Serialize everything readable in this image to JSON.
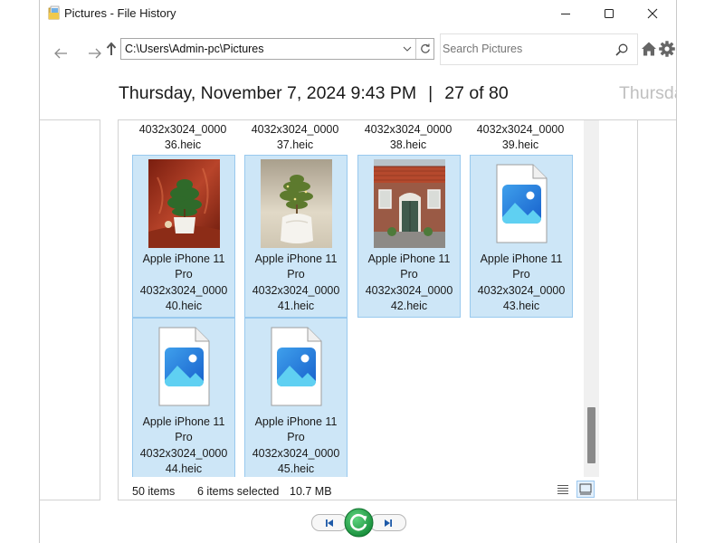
{
  "window": {
    "title": "Pictures - File History"
  },
  "address": {
    "path": "C:\\Users\\Admin-pc\\Pictures"
  },
  "search": {
    "placeholder": "Search Pictures"
  },
  "header": {
    "date": "Thursday, November 7, 2024 9:43 PM",
    "separator": "|",
    "position": "27 of 80",
    "next_date_partial": "Thursda"
  },
  "files": {
    "top_row": [
      {
        "line1": "4032x3024_0000",
        "line2": "36.heic"
      },
      {
        "line1": "4032x3024_0000",
        "line2": "37.heic"
      },
      {
        "line1": "4032x3024_0000",
        "line2": "38.heic"
      },
      {
        "line1": "4032x3024_0000",
        "line2": "39.heic"
      }
    ],
    "tiles": [
      {
        "line1": "Apple iPhone 11",
        "line2": "Pro",
        "line3": "4032x3024_0000",
        "line4": "40.heic",
        "thumbnail": "plant-red-background-photo"
      },
      {
        "line1": "Apple iPhone 11",
        "line2": "Pro",
        "line3": "4032x3024_0000",
        "line4": "41.heic",
        "thumbnail": "plant-white-background-photo"
      },
      {
        "line1": "Apple iPhone 11",
        "line2": "Pro",
        "line3": "4032x3024_0000",
        "line4": "42.heic",
        "thumbnail": "brick-house-photo"
      },
      {
        "line1": "Apple iPhone 11",
        "line2": "Pro",
        "line3": "4032x3024_0000",
        "line4": "43.heic",
        "thumbnail": "image-file-icon"
      },
      {
        "line1": "Apple iPhone 11",
        "line2": "Pro",
        "line3": "4032x3024_0000",
        "line4": "44.heic",
        "thumbnail": "image-file-icon"
      },
      {
        "line1": "Apple iPhone 11",
        "line2": "Pro",
        "line3": "4032x3024_0000",
        "line4": "45.heic",
        "thumbnail": "image-file-icon"
      }
    ]
  },
  "status": {
    "items": "50 items",
    "selected": "6 items selected",
    "size": "10.7 MB"
  },
  "colors": {
    "selection_bg": "#cde6f7",
    "selection_border": "#99c9ee",
    "restore_green": "#1fa34a",
    "file_icon_blue": "#1e73d8"
  }
}
